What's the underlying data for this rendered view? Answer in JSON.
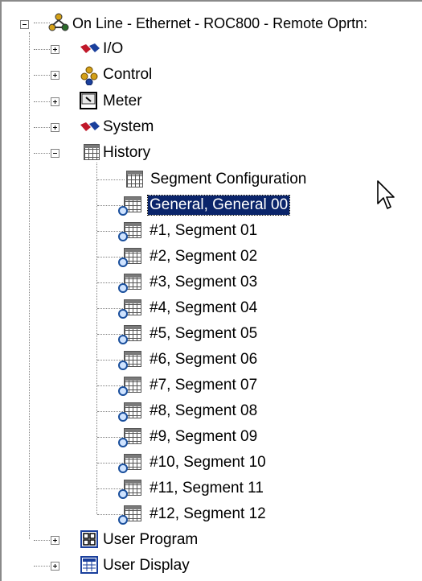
{
  "tree": {
    "root": {
      "label": "On Line - Ethernet - ROC800 - Remote Oprtn:"
    },
    "top_nodes": [
      {
        "label": "I/O",
        "icon": "io-icon",
        "expanded": false
      },
      {
        "label": "Control",
        "icon": "control-icon",
        "expanded": false
      },
      {
        "label": "Meter",
        "icon": "meter-icon",
        "expanded": false
      },
      {
        "label": "System",
        "icon": "system-icon",
        "expanded": false
      },
      {
        "label": "History",
        "icon": "history-icon",
        "expanded": true
      }
    ],
    "history_children": [
      {
        "label": "Segment Configuration",
        "icon": "segment-config-icon"
      },
      {
        "label": "General, General 00",
        "icon": "segment-icon",
        "selected": true
      },
      {
        "label": "#1, Segment 01",
        "icon": "segment-icon"
      },
      {
        "label": "#2, Segment 02",
        "icon": "segment-icon"
      },
      {
        "label": "#3, Segment 03",
        "icon": "segment-icon"
      },
      {
        "label": "#4, Segment 04",
        "icon": "segment-icon"
      },
      {
        "label": "#5, Segment 05",
        "icon": "segment-icon"
      },
      {
        "label": "#6, Segment 06",
        "icon": "segment-icon"
      },
      {
        "label": "#7, Segment 07",
        "icon": "segment-icon"
      },
      {
        "label": "#8, Segment 08",
        "icon": "segment-icon"
      },
      {
        "label": "#9, Segment 09",
        "icon": "segment-icon"
      },
      {
        "label": "#10, Segment 10",
        "icon": "segment-icon"
      },
      {
        "label": "#11, Segment 11",
        "icon": "segment-icon"
      },
      {
        "label": "#12, Segment 12",
        "icon": "segment-icon"
      }
    ],
    "bottom_nodes": [
      {
        "label": "User Program",
        "icon": "user-program-icon",
        "expanded": false
      },
      {
        "label": "User Display",
        "icon": "user-display-icon",
        "expanded": false
      }
    ]
  },
  "colors": {
    "selection": "#0a246a",
    "background": "#ffffff"
  }
}
